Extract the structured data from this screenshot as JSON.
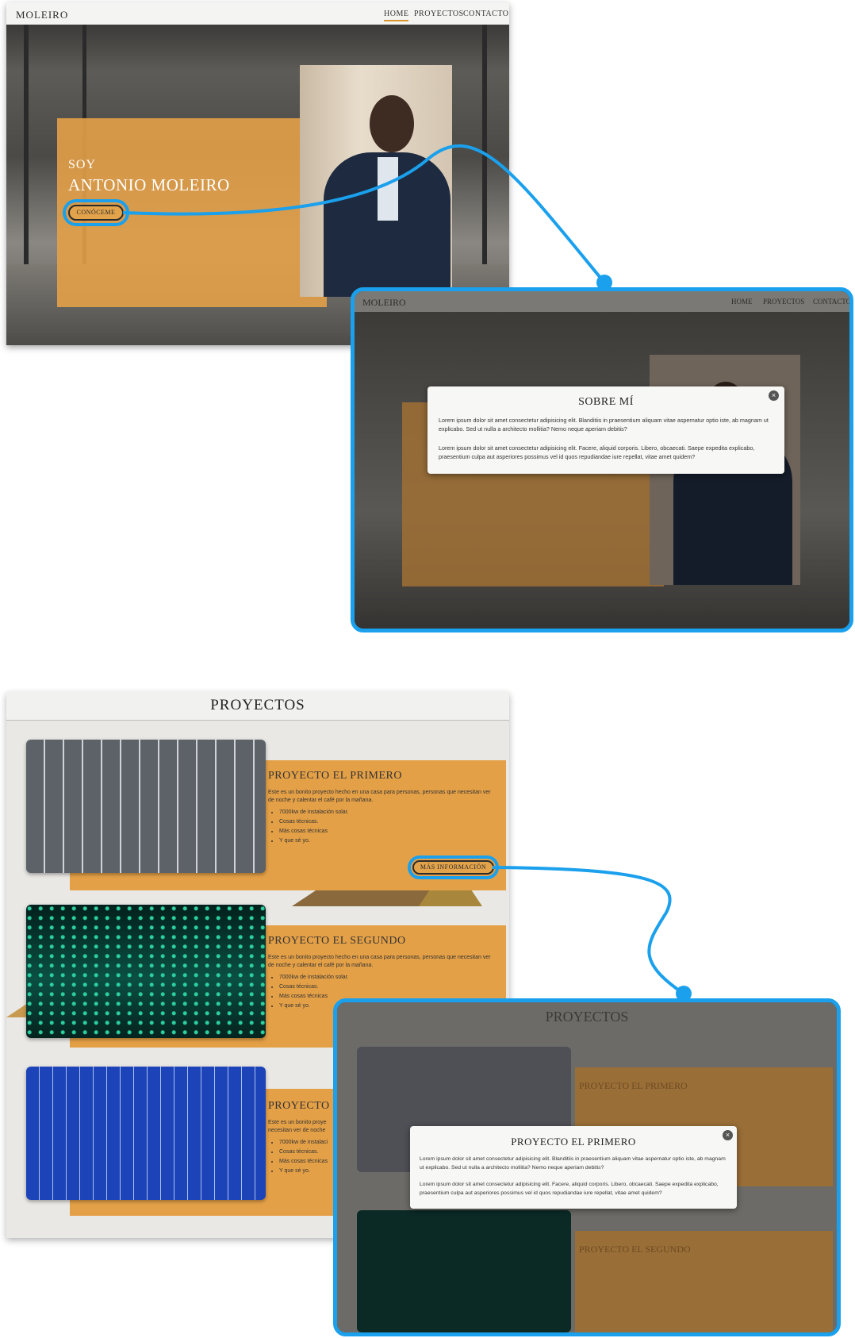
{
  "hero": {
    "logo": "MOLEIRO",
    "nav": [
      "HOME",
      "PROYECTOS",
      "CONTACTO"
    ],
    "soy": "SOY",
    "name": "ANTONIO MOLEIRO",
    "cta": "CONÓCEME"
  },
  "about_modal": {
    "nav_logo": "MOLEIRO",
    "nav": [
      "HOME",
      "PROYECTOS",
      "CONTACTO"
    ],
    "title": "SOBRE MÍ",
    "close": "×",
    "p1": "Lorem ipsum dolor sit amet consectetur adipisicing elit. Blanditiis in praesentium aliquam vitae aspernatur optio iste, ab magnam ut explicabo. Sed ut nulla a architecto mollitia? Nemo neque aperiam debitis?",
    "p2": "Lorem ipsum dolor sit amet consectetur adipisicing elit. Facere, aliquid corporis. Libero, obcaecati. Saepe expedita explicabo, praesentium culpa aut asperiores possimus vel id quos repudiandae iure repellat, vitae amet quidem?"
  },
  "projects": {
    "heading": "PROYECTOS",
    "more_info": "MÁS INFORMACIÓN",
    "cards": [
      {
        "title": "PROYECTO EL PRIMERO",
        "desc": "Este es un bonito proyecto hecho en una casa para personas, personas que necesitan ver de noche y calentar el café por la mañana.",
        "bullets": [
          "7000kw de instalación solar.",
          "Cosas técnicas.",
          "Más cosas técnicas",
          "Y que sé yo."
        ]
      },
      {
        "title": "PROYECTO EL SEGUNDO",
        "desc": "Este es un bonito proyecto hecho en una casa para personas, personas que necesitan ver de noche y calentar el café por la mañana.",
        "bullets": [
          "7000kw de instalación solar.",
          "Cosas técnicas.",
          "Más cosas técnicas",
          "Y que sé yo."
        ]
      },
      {
        "title": "PROYECTO",
        "desc": "Este es un bonito proye necesitan ver de noche",
        "bullets": [
          "7000kw de instalaci",
          "Cosas técnicas.",
          "Más cosas técnicas",
          "Y que sé yo."
        ]
      }
    ]
  },
  "project_modal": {
    "heading": "PROYECTOS",
    "title": "PROYECTO EL PRIMERO",
    "close": "×",
    "p1": "Lorem ipsum dolor sit amet consectetur adipisicing elit. Blanditiis in praesentium aliquam vitae aspernatur optio iste, ab magnam ut explicabo. Sed ut nulla a architecto mollitia? Nemo neque aperiam debitis?",
    "p2": "Lorem ipsum dolor sit amet consectetur adipisicing elit. Facere, aliquid corporis. Libero, obcaecati. Saepe expedita explicabo, praesentium culpa aut asperiores possimus vel id quos repudiandae iure repellat, vitae amet quidem?",
    "bg_card1_title": "PROYECTO EL PRIMERO",
    "bg_card2_title": "PROYECTO EL SEGUNDO"
  },
  "colors": {
    "accent": "#1aa0ec",
    "orange": "#e4a047",
    "dark": "#2b2b2b"
  }
}
